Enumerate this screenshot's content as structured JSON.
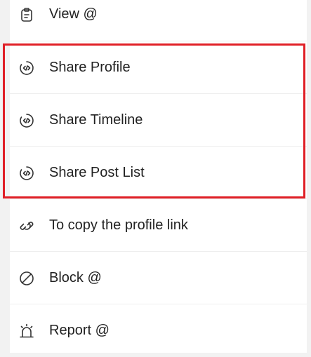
{
  "menu": {
    "items": [
      {
        "label": "View @",
        "icon": "clipboard-icon"
      },
      {
        "label": "Share Profile",
        "icon": "code-share-icon"
      },
      {
        "label": "Share Timeline",
        "icon": "code-share-icon"
      },
      {
        "label": "Share Post List",
        "icon": "code-share-icon"
      },
      {
        "label": "To copy the profile link",
        "icon": "link-icon"
      },
      {
        "label": "Block @",
        "icon": "block-icon"
      },
      {
        "label": "Report @",
        "icon": "alarm-icon"
      }
    ]
  },
  "colors": {
    "highlight_border": "#e01f26",
    "text": "#222222",
    "background": "#f2f2f2",
    "panel": "#ffffff"
  }
}
